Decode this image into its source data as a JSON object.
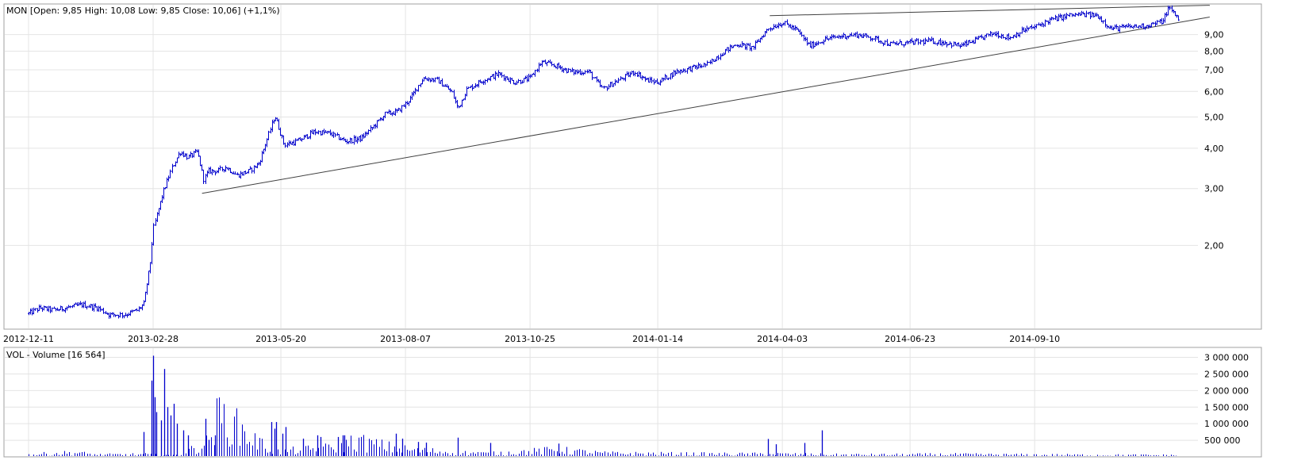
{
  "colors": {
    "price": "#0000cc",
    "volume": "#0000cc",
    "trendline": "#404040",
    "grid": "#e4e4e4",
    "frame": "#a0a0a0"
  },
  "chart_data": [
    {
      "type": "ohlc",
      "title": "MON [Open: 9,85  High: 10,08  Low: 9,85  Close: 10,06] (+1,1%)",
      "x_tick_labels": [
        "2012-12-11",
        "2013-02-28",
        "2013-05-20",
        "2013-08-07",
        "2013-10-25",
        "2014-01-14",
        "2014-04-03",
        "2014-06-23",
        "2014-09-10"
      ],
      "y_scale": "log",
      "y_tick_values": [
        2,
        3,
        4,
        5,
        6,
        7,
        8,
        9
      ],
      "y_tick_labels": [
        "2,00",
        "3,00",
        "4,00",
        "5,00",
        "6,00",
        "7,00",
        "8,00",
        "9,00"
      ],
      "ylim": [
        1.1,
        11.2
      ],
      "grid": true,
      "series_path": [
        [
          "2012-12-11",
          1.23
        ],
        [
          "2012-12-18",
          1.28
        ],
        [
          "2012-12-27",
          1.26
        ],
        [
          "2013-01-07",
          1.29
        ],
        [
          "2013-01-14",
          1.31
        ],
        [
          "2013-01-24",
          1.28
        ],
        [
          "2013-01-31",
          1.22
        ],
        [
          "2013-02-10",
          1.22
        ],
        [
          "2013-02-18",
          1.26
        ],
        [
          "2013-02-22",
          1.32
        ],
        [
          "2013-02-26",
          1.75
        ],
        [
          "2013-02-28",
          2.25
        ],
        [
          "2013-03-06",
          2.9
        ],
        [
          "2013-03-12",
          3.5
        ],
        [
          "2013-03-17",
          3.9
        ],
        [
          "2013-03-22",
          3.75
        ],
        [
          "2013-03-28",
          3.9
        ],
        [
          "2013-04-01",
          3.2
        ],
        [
          "2013-04-04",
          3.4
        ],
        [
          "2013-04-10",
          3.4
        ],
        [
          "2013-04-15",
          3.5
        ],
        [
          "2013-04-22",
          3.3
        ],
        [
          "2013-04-30",
          3.4
        ],
        [
          "2013-05-06",
          3.6
        ],
        [
          "2013-05-12",
          4.4
        ],
        [
          "2013-05-16",
          5.05
        ],
        [
          "2013-05-22",
          4.1
        ],
        [
          "2013-05-30",
          4.2
        ],
        [
          "2013-06-10",
          4.5
        ],
        [
          "2013-06-20",
          4.45
        ],
        [
          "2013-06-30",
          4.2
        ],
        [
          "2013-07-10",
          4.3
        ],
        [
          "2013-07-18",
          4.7
        ],
        [
          "2013-07-25",
          5.1
        ],
        [
          "2013-08-02",
          5.2
        ],
        [
          "2013-08-10",
          5.7
        ],
        [
          "2013-08-18",
          6.6
        ],
        [
          "2013-08-27",
          6.5
        ],
        [
          "2013-09-05",
          6.0
        ],
        [
          "2013-09-09",
          5.3
        ],
        [
          "2013-09-15",
          6.1
        ],
        [
          "2013-09-25",
          6.5
        ],
        [
          "2013-10-05",
          6.8
        ],
        [
          "2013-10-15",
          6.4
        ],
        [
          "2013-10-25",
          6.6
        ],
        [
          "2013-11-01",
          7.4
        ],
        [
          "2013-11-10",
          7.2
        ],
        [
          "2013-11-20",
          6.9
        ],
        [
          "2013-12-01",
          6.9
        ],
        [
          "2013-12-10",
          6.1
        ],
        [
          "2013-12-20",
          6.5
        ],
        [
          "2013-12-30",
          6.9
        ],
        [
          "2014-01-07",
          6.5
        ],
        [
          "2014-01-14",
          6.4
        ],
        [
          "2014-01-25",
          6.9
        ],
        [
          "2014-02-05",
          7.1
        ],
        [
          "2014-02-15",
          7.3
        ],
        [
          "2014-02-25",
          8.0
        ],
        [
          "2014-03-05",
          8.4
        ],
        [
          "2014-03-15",
          8.2
        ],
        [
          "2014-03-25",
          9.4
        ],
        [
          "2014-04-03",
          9.8
        ],
        [
          "2014-04-12",
          9.3
        ],
        [
          "2014-04-20",
          8.3
        ],
        [
          "2014-04-30",
          8.7
        ],
        [
          "2014-05-10",
          8.9
        ],
        [
          "2014-05-20",
          9.0
        ],
        [
          "2014-05-30",
          8.8
        ],
        [
          "2014-06-10",
          8.4
        ],
        [
          "2014-06-23",
          8.5
        ],
        [
          "2014-07-05",
          8.6
        ],
        [
          "2014-07-15",
          8.5
        ],
        [
          "2014-07-25",
          8.3
        ],
        [
          "2014-08-05",
          8.7
        ],
        [
          "2014-08-15",
          9.1
        ],
        [
          "2014-08-25",
          8.8
        ],
        [
          "2014-09-03",
          9.3
        ],
        [
          "2014-09-10",
          9.5
        ],
        [
          "2014-09-20",
          10.0
        ],
        [
          "2014-10-01",
          10.3
        ],
        [
          "2014-10-10",
          10.4
        ],
        [
          "2014-10-20",
          10.3
        ],
        [
          "2014-10-28",
          9.4
        ],
        [
          "2014-11-08",
          9.5
        ],
        [
          "2014-11-20",
          9.6
        ],
        [
          "2014-11-30",
          9.9
        ],
        [
          "2014-12-04",
          10.9
        ],
        [
          "2014-12-10",
          10.1
        ]
      ],
      "trendlines": [
        [
          [
            "2013-03-31",
            2.9
          ],
          [
            "2014-12-30",
            10.2
          ]
        ],
        [
          [
            "2014-03-26",
            10.3
          ],
          [
            "2014-12-30",
            11.1
          ]
        ]
      ]
    },
    {
      "type": "bar",
      "title": "VOL - Volume [16 564]",
      "x_tick_labels": [
        "2012-12-11",
        "2013-02-28",
        "2013-05-20",
        "2013-08-07",
        "2013-10-25",
        "2014-01-14",
        "2014-04-03",
        "2014-06-23",
        "2014-09-10"
      ],
      "y_tick_values": [
        500000,
        1000000,
        1500000,
        2000000,
        2500000,
        3000000
      ],
      "y_tick_labels": [
        "500 000",
        "1 000 000",
        "1 500 000",
        "2 000 000",
        "2 500 000",
        "3 000 000"
      ],
      "ylim": [
        0,
        3300000
      ],
      "grid": true,
      "volume_profile": [
        [
          0.0,
          60000
        ],
        [
          0.015,
          90000
        ],
        [
          0.04,
          120000
        ],
        [
          0.06,
          60000
        ],
        [
          0.1,
          70000
        ],
        [
          0.13,
          50000
        ],
        [
          0.155,
          400000
        ],
        [
          0.165,
          1200000
        ],
        [
          0.18,
          900000
        ],
        [
          0.2,
          400000
        ],
        [
          0.215,
          150000
        ],
        [
          0.26,
          250000
        ],
        [
          0.285,
          450000
        ],
        [
          0.31,
          300000
        ],
        [
          0.33,
          200000
        ],
        [
          0.36,
          150000
        ],
        [
          0.4,
          90000
        ],
        [
          0.46,
          200000
        ],
        [
          0.5,
          100000
        ],
        [
          0.55,
          90000
        ],
        [
          0.6,
          80000
        ],
        [
          0.65,
          80000
        ],
        [
          0.7,
          60000
        ],
        [
          0.75,
          60000
        ],
        [
          0.8,
          70000
        ],
        [
          0.85,
          60000
        ],
        [
          0.9,
          55000
        ],
        [
          0.95,
          50000
        ],
        [
          1.0,
          45000
        ]
      ],
      "volume_spikes": [
        [
          "2013-02-22",
          750000
        ],
        [
          "2013-02-27",
          2300000
        ],
        [
          "2013-02-28",
          3050000
        ],
        [
          "2013-03-01",
          1800000
        ],
        [
          "2013-03-02",
          1350000
        ],
        [
          "2013-03-05",
          1100000
        ],
        [
          "2013-03-07",
          2650000
        ],
        [
          "2013-03-09",
          1500000
        ],
        [
          "2013-03-11",
          1250000
        ],
        [
          "2013-03-13",
          1600000
        ],
        [
          "2013-03-15",
          1000000
        ],
        [
          "2013-03-19",
          800000
        ],
        [
          "2013-03-22",
          650000
        ],
        [
          "2013-04-02",
          1150000
        ],
        [
          "2013-04-04",
          500000
        ],
        [
          "2013-04-08",
          650000
        ],
        [
          "2013-05-14",
          1050000
        ],
        [
          "2013-05-16",
          850000
        ],
        [
          "2013-05-17",
          1050000
        ],
        [
          "2013-05-21",
          700000
        ],
        [
          "2013-05-23",
          900000
        ],
        [
          "2013-06-03",
          550000
        ],
        [
          "2013-06-12",
          650000
        ],
        [
          "2013-06-14",
          600000
        ],
        [
          "2013-06-25",
          600000
        ],
        [
          "2013-06-28",
          650000
        ],
        [
          "2013-06-29",
          650000
        ],
        [
          "2013-08-01",
          700000
        ],
        [
          "2013-08-05",
          550000
        ],
        [
          "2013-08-15",
          450000
        ],
        [
          "2013-08-20",
          430000
        ],
        [
          "2013-09-09",
          580000
        ],
        [
          "2013-09-30",
          420000
        ],
        [
          "2013-11-12",
          400000
        ],
        [
          "2014-03-25",
          540000
        ],
        [
          "2014-04-28",
          800000
        ],
        [
          "2014-04-17",
          420000
        ],
        [
          "2014-03-30",
          380000
        ]
      ]
    }
  ]
}
